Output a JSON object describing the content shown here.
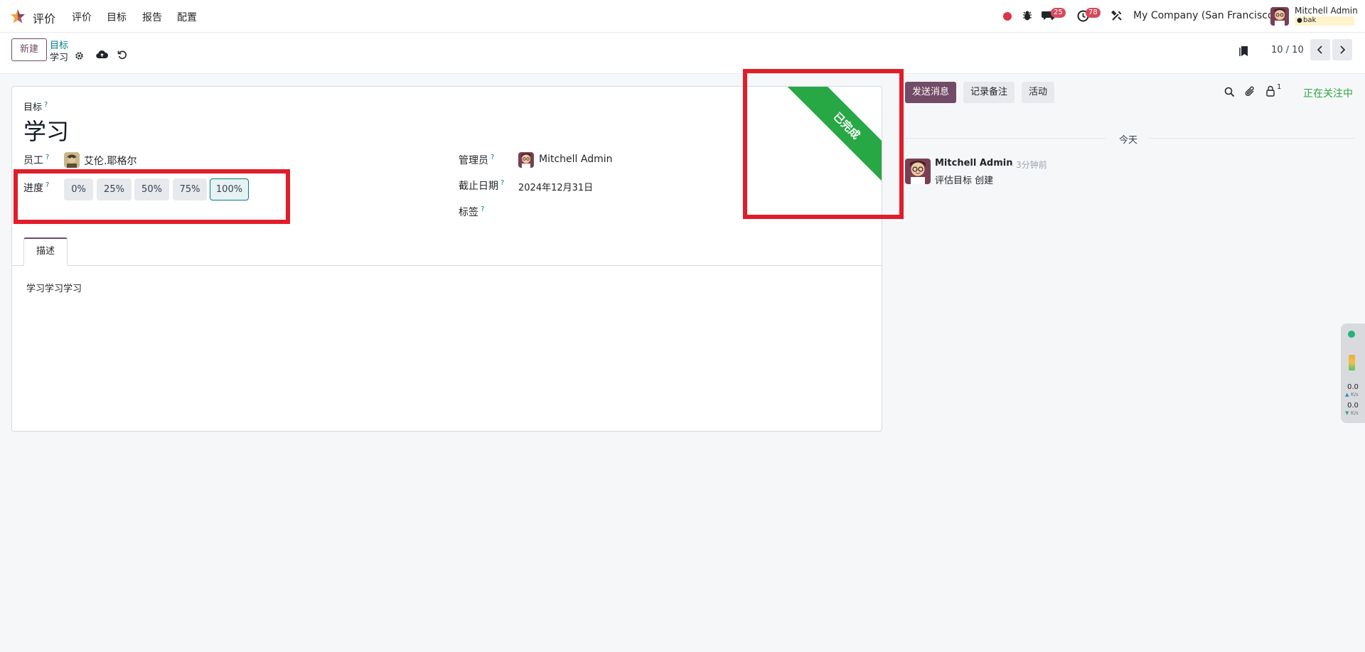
{
  "navbar": {
    "app_name": "评价",
    "menu": [
      "评价",
      "目标",
      "报告",
      "配置"
    ],
    "messages_count": "25",
    "activities_count": "78",
    "company": "My Company (San Francisco)",
    "user_name": "Mitchell Admin",
    "db_name": "bak"
  },
  "control_panel": {
    "new_button": "新建",
    "breadcrumb_parent": "目标",
    "breadcrumb_current": "学习",
    "pager": "10 / 10"
  },
  "form": {
    "goal_label": "目标",
    "goal_title": "学习",
    "employee_label": "员工",
    "employee_value": "艾伦.耶格尔",
    "progress_label": "进度",
    "progress_options": [
      "0%",
      "25%",
      "50%",
      "75%",
      "100%"
    ],
    "progress_selected": "100%",
    "manager_label": "管理员",
    "manager_value": "Mitchell Admin",
    "deadline_label": "截止日期",
    "deadline_value": "2024年12月31日",
    "tags_label": "标签",
    "help_mark": "?",
    "ribbon": "已完成",
    "tab_description": "描述",
    "description": "学习学习学习"
  },
  "chatter": {
    "send_message": "发送消息",
    "log_note": "记录备注",
    "activities": "活动",
    "followers_count": "1",
    "following": "正在关注中",
    "date_separator": "今天",
    "message_author": "Mitchell Admin",
    "message_time": "- 3分钟前",
    "message_body": "评估目标 创建"
  },
  "side_widget": {
    "upload_speed": "0.0",
    "upload_unit": "K/s",
    "download_speed": "0.0",
    "download_unit": "K/s"
  },
  "colors": {
    "brand": "#714b67",
    "teal": "#017e84",
    "ribbon_green": "#28a745",
    "highlight_red": "#e11d2a",
    "badge_red": "#d44a5c"
  }
}
